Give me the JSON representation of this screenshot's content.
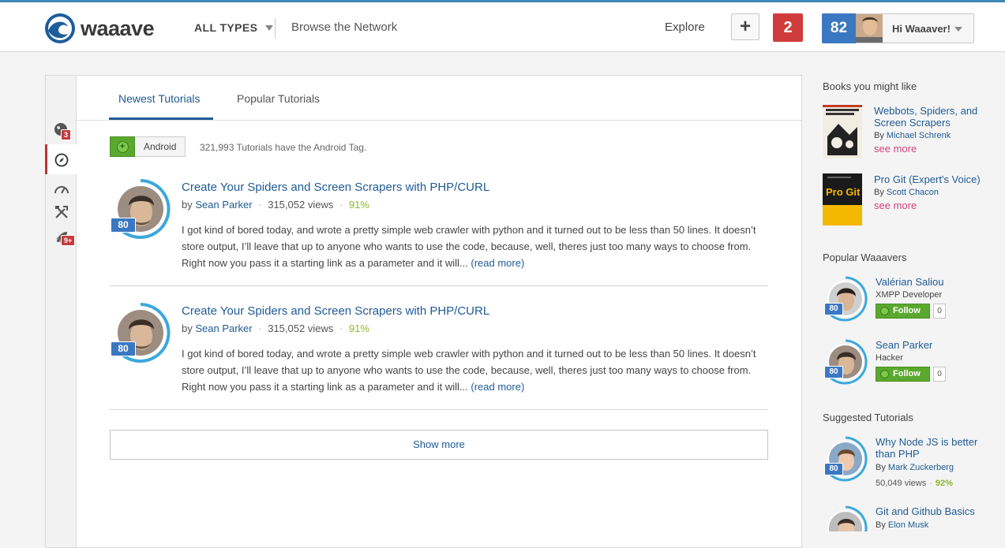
{
  "header": {
    "logo_text": "waaave",
    "types_label": "ALL TYPES",
    "browse_label": "Browse the Network",
    "explore_label": "Explore",
    "add_label": "+",
    "notifications_count": "2",
    "user_score": "82",
    "user_greeting": "Hi Waaaver!"
  },
  "leftnav": {
    "items": [
      {
        "icon": "globe-icon",
        "badge": "3"
      },
      {
        "icon": "compass-icon",
        "active": true
      },
      {
        "icon": "speedometer-icon"
      },
      {
        "icon": "tools-icon"
      },
      {
        "icon": "rocket-icon",
        "badge": "9+"
      }
    ]
  },
  "tabs": [
    {
      "label": "Newest Tutorials",
      "active": true
    },
    {
      "label": "Popular Tutorials",
      "active": false
    }
  ],
  "tag": {
    "name": "Android",
    "count_text": "321,993 Tutorials have the Android Tag."
  },
  "posts": [
    {
      "title": "Create Your Spiders and Screen Scrapers with PHP/CURL",
      "by": "by",
      "author": "Sean Parker",
      "views": "315,052 views",
      "rating": "91%",
      "score": "80",
      "excerpt": "I got kind of bored today, and wrote a pretty simple web crawler with python and it turned out to be less than 50 lines. It doesn’t store output, I’ll leave that up to anyone who wants to use the code, because, well, theres just too many ways to choose from. Right now you pass it a starting link as a parameter and it will...",
      "read_more": "(read more)"
    },
    {
      "title": "Create Your Spiders and Screen Scrapers with PHP/CURL",
      "by": "by",
      "author": "Sean Parker",
      "views": "315,052 views",
      "rating": "91%",
      "score": "80",
      "excerpt": "I got kind of bored today, and wrote a pretty simple web crawler with python and it turned out to be less than 50 lines. It doesn’t store output, I’ll leave that up to anyone who wants to use the code, because, well, theres just too many ways to choose from. Right now you pass it a starting link as a parameter and it will...",
      "read_more": "(read more)"
    }
  ],
  "show_more_label": "Show more",
  "sidebar": {
    "books_heading": "Books you might like",
    "books": [
      {
        "title": "Webbots, Spiders, and Screen Scrapers",
        "by": "By",
        "author": "Michael Schrenk",
        "see_more": "see more"
      },
      {
        "title": "Pro Git (Expert's Voice)",
        "by": "By",
        "author": "Scott Chacon",
        "see_more": "see more",
        "cover_text": "Pro Git"
      }
    ],
    "waaavers_heading": "Popular Waaavers",
    "waaavers": [
      {
        "name": "Valérian Saliou",
        "role": "XMPP Developer",
        "score": "80",
        "follow_label": "Follow",
        "followers": "0"
      },
      {
        "name": "Sean Parker",
        "role": "Hacker",
        "score": "80",
        "follow_label": "Follow",
        "followers": "0"
      }
    ],
    "suggested_heading": "Suggested Tutorials",
    "suggested": [
      {
        "title": "Why Node JS is better than PHP",
        "by": "By",
        "author": "Mark Zuckerberg",
        "views": "50,049 views",
        "rating": "92%",
        "score": "80"
      },
      {
        "title": "Git and Github Basics",
        "by": "By",
        "author": "Elon Musk"
      }
    ]
  },
  "colors": {
    "brand_blue": "#1f5b95",
    "score_blue": "#3b78c2",
    "alert_red": "#d03c3c",
    "follow_green": "#5ba82f",
    "rating_green": "#8cb82c",
    "see_more_pink": "#d2437b"
  }
}
